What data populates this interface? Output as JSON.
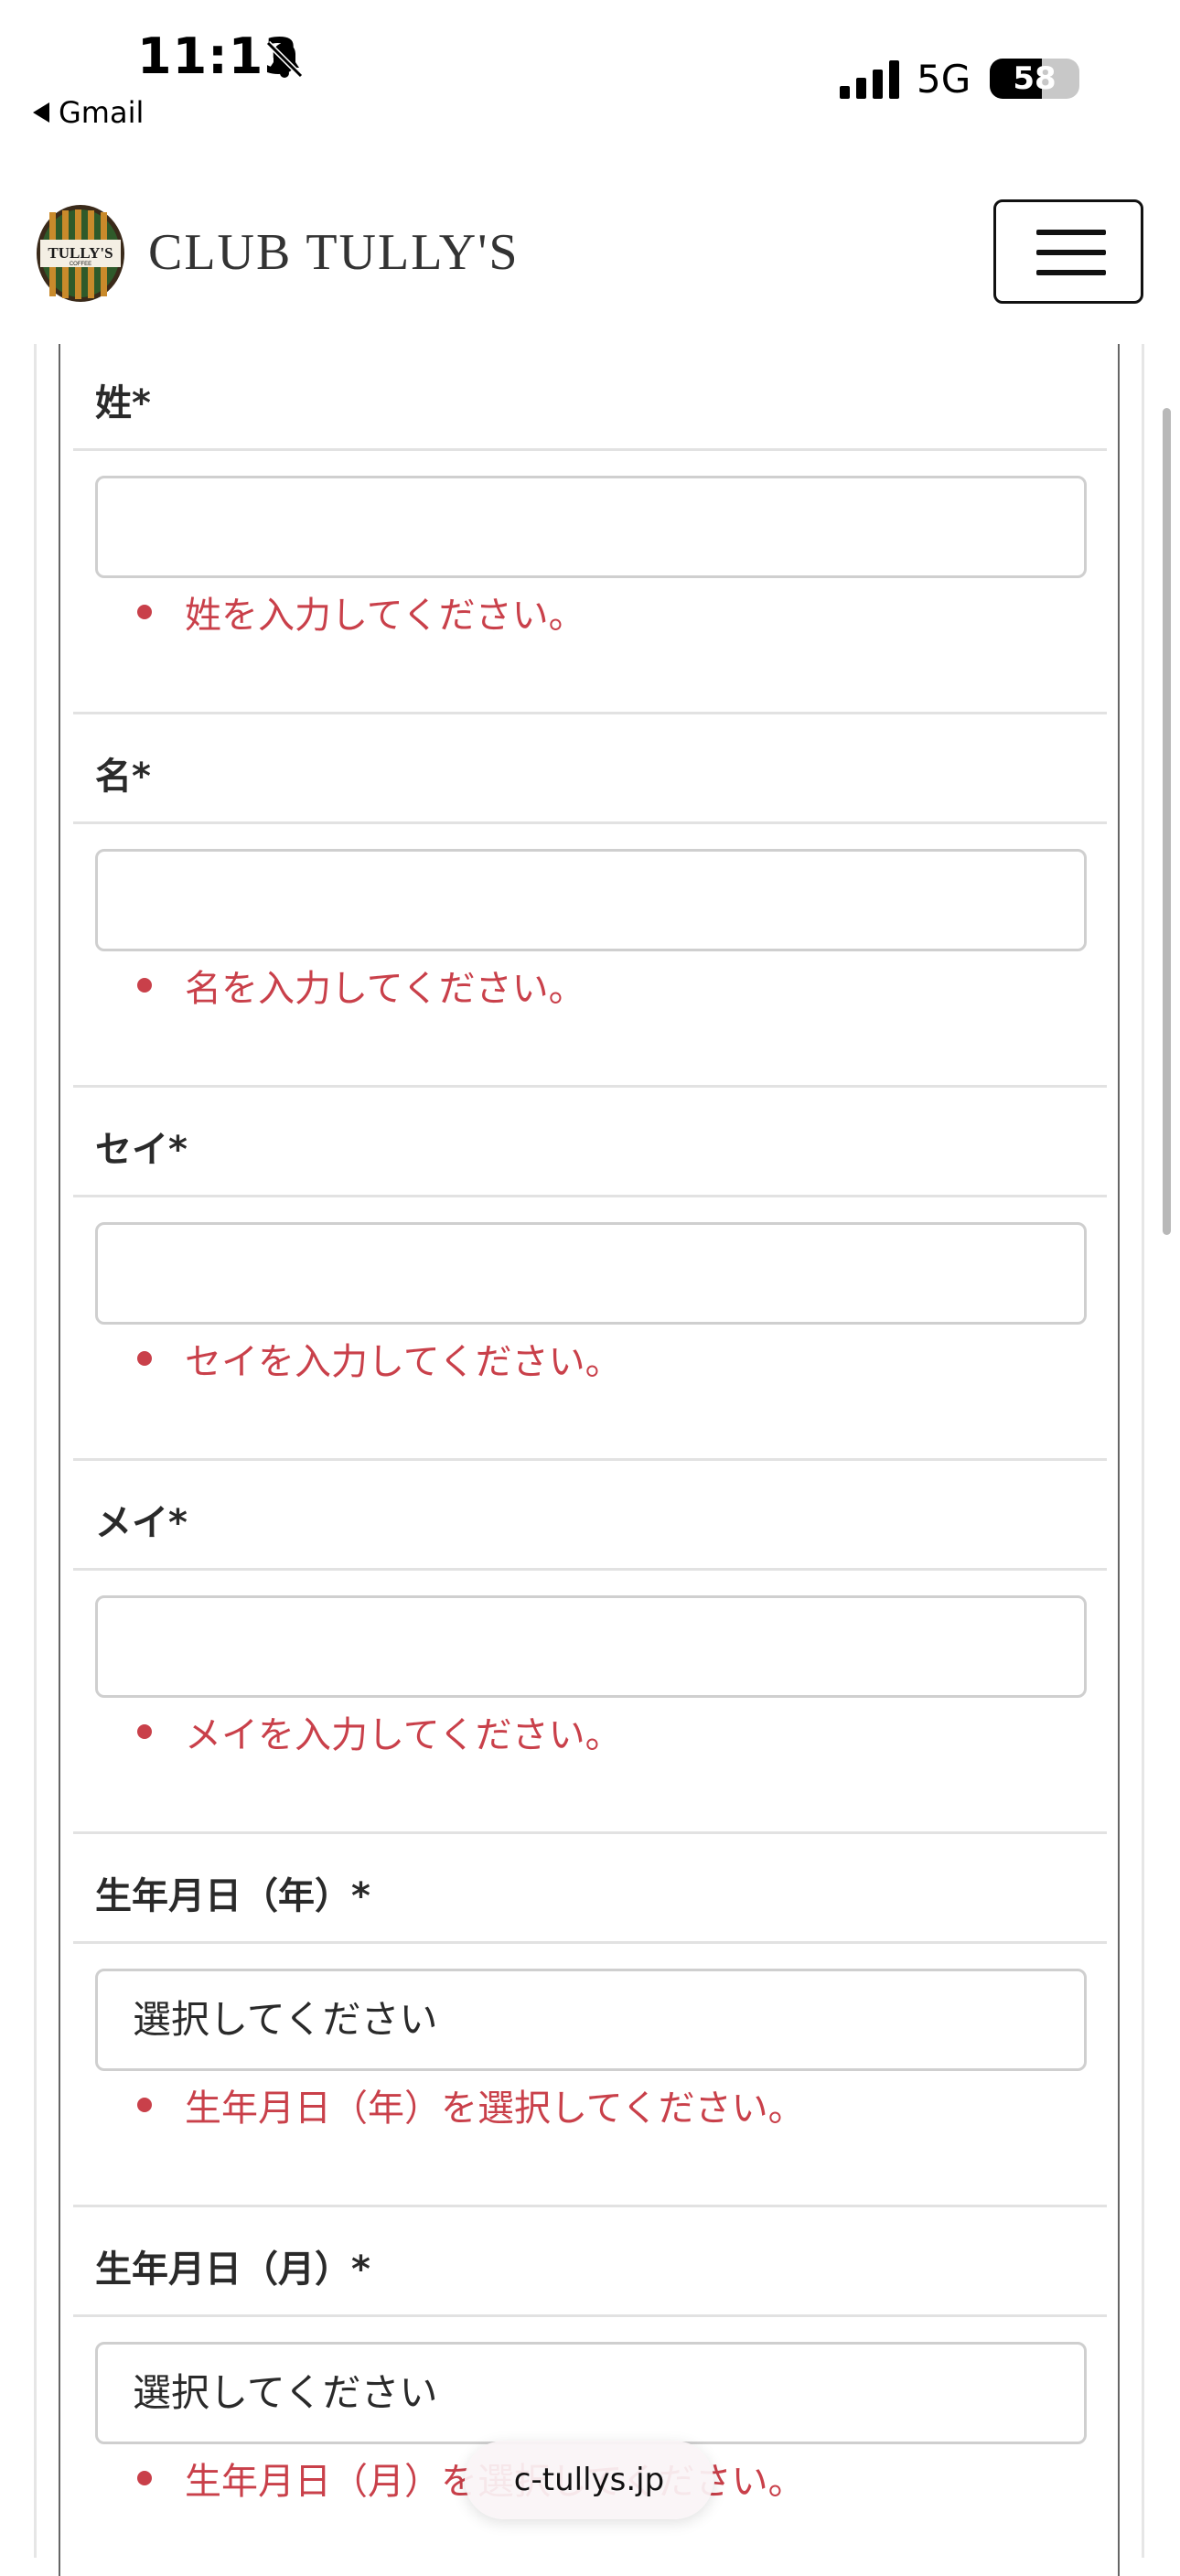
{
  "status_bar": {
    "time": "11:13",
    "back_app": "Gmail",
    "network": "5G",
    "battery": "58",
    "battery_level": 0.58
  },
  "header": {
    "brand": "CLUB TULLY'S",
    "logo_text_top": "TULLY'S",
    "logo_text_bottom": "COFFEE",
    "menu_icon": "hamburger-menu-icon"
  },
  "form": {
    "fields": [
      {
        "label": "姓*",
        "value": "",
        "error": "姓を入力してください。"
      },
      {
        "label": "名*",
        "value": "",
        "error": "名を入力してください。"
      },
      {
        "label": "セイ*",
        "value": "",
        "error": "セイを入力してください。"
      },
      {
        "label": "メイ*",
        "value": "",
        "error": "メイを入力してください。"
      },
      {
        "label": "生年月日（年）*",
        "value": "選択してください",
        "error": "生年月日（年）を選択してください。"
      },
      {
        "label": "生年月日（月）*",
        "value": "選択してください",
        "error": "生年月日（月）を選択してください。"
      }
    ]
  },
  "browser": {
    "url": "c-tullys.jp"
  },
  "colors": {
    "error": "#c9404a",
    "border": "#cfcfcf",
    "separator": "#e2e2e2"
  }
}
